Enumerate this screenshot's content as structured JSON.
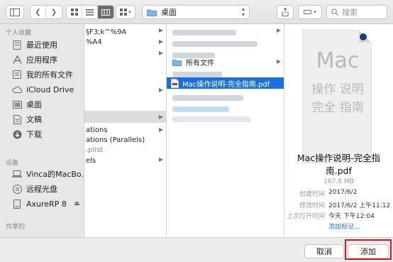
{
  "toolbar": {
    "path_label": "桌面",
    "search_placeholder": "搜索"
  },
  "sidebar": {
    "favorites_header": "个人收藏",
    "favorites": [
      "最近使用",
      "应用程序",
      "我的所有文件",
      "iCloud Drive",
      "桌面",
      "文稿",
      "下载"
    ],
    "devices_header": "设备",
    "devices": [
      "Vinca的MacBo...",
      "远程光盘",
      "AxureRP 8"
    ],
    "shared_header": "共享的"
  },
  "column1": {
    "items": [
      "§F3;k^%9A",
      "%A4",
      "ations",
      "ations (Parallels)",
      ".plist",
      "els"
    ]
  },
  "column2": {
    "items": [
      "所有文件",
      "Mac操作说明-完全指南.pdf"
    ]
  },
  "preview": {
    "thumb_title": "Mac",
    "thumb_line1": "操作 说明",
    "thumb_line2": "完全 指南",
    "file_name_line1": "Mac操作说明-完全指",
    "file_name_line2": "南.pdf",
    "size": "167.8 MB",
    "meta": [
      {
        "key": "创建时间",
        "value": "2017/6/2"
      },
      {
        "key": "修改时间",
        "value": "2017/6/2 上午11:12"
      },
      {
        "key": "上次打开时间",
        "value": "今天 下午12:04"
      }
    ],
    "add_tags": "添加标记..."
  },
  "footer": {
    "cancel_label": "取消",
    "add_label": "添加"
  },
  "colors": {
    "selection": "#1a6fde",
    "highlight_box": "#e0181c"
  }
}
